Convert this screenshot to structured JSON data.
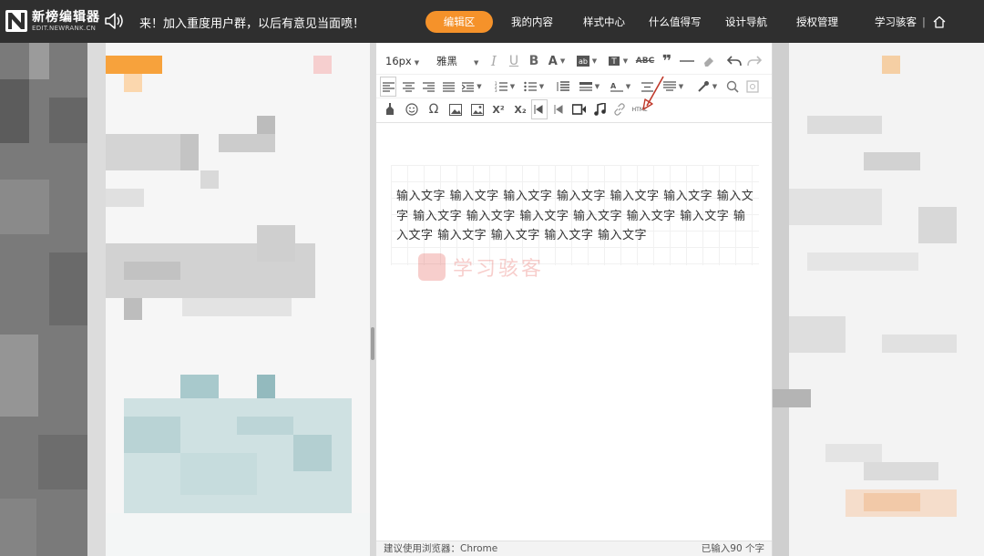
{
  "header": {
    "logo_cn": "新榜编辑器",
    "logo_en": "EDIT.NEWRANK.CN",
    "announcement": "来！加入重度用户群，以后有意见当面喷！",
    "nav": [
      {
        "label": "编辑区",
        "active": true
      },
      {
        "label": "我的内容",
        "active": false
      },
      {
        "label": "样式中心",
        "active": false
      },
      {
        "label": "什么值得写",
        "active": false
      },
      {
        "label": "设计导航",
        "active": false
      },
      {
        "label": "授权管理",
        "active": false
      },
      {
        "label": "学习骇客",
        "active": false
      }
    ],
    "separator": "|",
    "icons": [
      "newrank-logo-icon",
      "speaker-icon",
      "home-icon"
    ]
  },
  "toolbar": {
    "font_size": "16px",
    "font_family": "雅黑",
    "row1_icons": [
      "italic-icon",
      "underline-icon",
      "bold-icon",
      "font-color-icon",
      "background-color-icon",
      "text-format-icon",
      "strikethrough-icon",
      "quote-icon",
      "horizontal-rule-icon",
      "eraser-icon",
      "undo-icon",
      "redo-icon"
    ],
    "strike_label": "ABC",
    "row2_icons": [
      "align-left-icon",
      "align-center-icon",
      "align-right-icon",
      "align-justify-icon",
      "indent-icon",
      "ordered-list-icon",
      "unordered-list-icon",
      "line-height-icon",
      "paragraph-spacing-icon",
      "letter-spacing-icon",
      "image-format-icon",
      "vertical-align-icon",
      "format-painter-icon",
      "search-replace-icon",
      "preview-icon"
    ],
    "row3_icons": [
      "emoji-icon",
      "smiley-icon",
      "special-char-icon",
      "image-icon",
      "multi-image-icon",
      "superscript-icon",
      "subscript-icon",
      "rtl-icon",
      "ltr-icon",
      "video-icon",
      "music-icon",
      "link-icon",
      "html-icon"
    ],
    "superscript_label": "X²",
    "subscript_label": "X₂",
    "omega_label": "Ω",
    "html_label": "HTML"
  },
  "editor": {
    "body": "输入文字 输入文字 输入文字 输入文字 输入文字 输入文字 输入文字 输入文字 输入文字 输入文字 输入文字 输入文字 输入文字 输入文字 输入文字 输入文字 输入文字 输入文字",
    "watermark": "学习骇客"
  },
  "status": {
    "browser_hint": "建议使用浏览器：Chrome",
    "char_count": "已输入90 个字"
  },
  "colors": {
    "topbar": "#2f2f2f",
    "accent": "#f5922a",
    "annotation_arrow": "#c0392b"
  }
}
